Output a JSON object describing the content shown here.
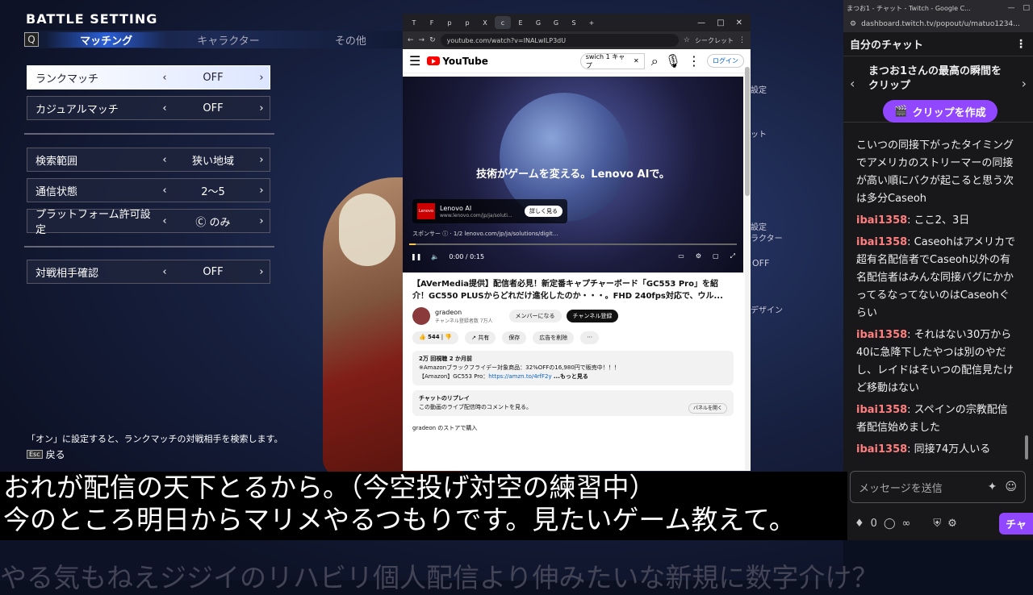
{
  "game": {
    "title": "BATTLE SETTING",
    "q_key": "Q",
    "tabs": [
      "マッチング",
      "キャラクター",
      "その他"
    ],
    "rows": [
      {
        "label": "ランクマッチ",
        "value": "OFF"
      },
      {
        "label": "カジュアルマッチ",
        "value": "OFF"
      },
      {
        "label": "検索範囲",
        "value": "狭い地域"
      },
      {
        "label": "通信状態",
        "value": "2～5"
      },
      {
        "label": "プラットフォーム許可設定",
        "value": "Ⓒ のみ"
      },
      {
        "label": "対戦相手確認",
        "value": "OFF"
      }
    ],
    "arrow_left": "‹",
    "arrow_right": "›",
    "hint": "「オン」に設定すると、ランクマッチの対戦相手を検索します。",
    "esc": "Esc",
    "back": "戻る",
    "peek": [
      "設定",
      "ット",
      "設定",
      "ラクター",
      "OFF",
      "デザイン"
    ]
  },
  "subtitles": {
    "line1": "おれが配信の天下とるから。（今空投げ対空の練習中）",
    "line2": "今のところ明日からマリメやるつもりです。見たいゲーム教えて。",
    "ghost": "やる気もねえジジイのリハビリ個人配信より伸みたいな新規に数字介け？"
  },
  "browser": {
    "tabs": [
      "T",
      "F",
      "p",
      "p",
      "X",
      "c",
      "E",
      "G",
      "G",
      "S"
    ],
    "url": "youtube.com/watch?v=INALwILP3dU",
    "incognito": "シークレット",
    "yt_logo": "YouTube",
    "search_value": "swich 1 キャプ",
    "login": "ログイン",
    "video_text": "技術がゲームを変える。Lenovo AIで。",
    "ad_logo": "Lenovo",
    "ad_name": "Lenovo AI",
    "ad_url": "www.lenovo.com/jp/ja/soluti...",
    "ad_button": "詳しく見る",
    "sponsor": "スポンサー ⓘ · 1/2  lenovo.com/jp/ja/solutions/digit...",
    "progress": 0.02,
    "time": "0:00 / 0:15",
    "video_title": "【AVerMedia提供】配信者必見！新定番キャプチャーボード「GC553 Pro」を紹介！GC550 PLUSからどれだけ進化したのか・・・。FHD 240fps対応で、ウル...",
    "channel": "gradeon",
    "subscribers": "チャンネル登録者数 7万人",
    "member_btn": "メンバーになる",
    "subscribe_btn": "チャンネル登録",
    "likes": "544",
    "share": "共有",
    "save": "保存",
    "remove_ad": "広告を削除",
    "desc_line1": "2万 回視聴  2 か月前",
    "desc_line2": "※Amazonブラックフライデー対象商品：32%OFFの16,980円で販売中！！！",
    "desc_line3_prefix": "【Amazon】GC553 Pro：",
    "desc_link": "https://amzn.to/4rfF2y",
    "desc_more": "...もっと見る",
    "replay_title": "チャットのリプレイ",
    "replay_text": "この動画のライブ配信時のコメントを見る。",
    "replay_btn": "パネルを開く",
    "store": "gradeon のストアで購入"
  },
  "twitch": {
    "window_title": "まつお1 - チャット - Twitch - Google C...",
    "url": "dashboard.twitch.tv/popout/u/matuo1234...",
    "header": "自分のチャット",
    "clip_text": "まつお1さんの最高の瞬間をクリップ",
    "clip_button": "クリップを作成",
    "messages": [
      {
        "user": "",
        "text": "こいつの同接下がったタイミングでアメリカのストリーマーの同接が高い順にバクが起こると思う次は多分Caseoh"
      },
      {
        "user": "ibai1358",
        "text": ": ここ2、3日"
      },
      {
        "user": "ibai1358",
        "text": ": Caseohはアメリカで超有名配信者でCaseoh以外の有名配信者はみんな同接バグにかかってるなってないのはCaseohぐらい"
      },
      {
        "user": "ibai1358",
        "text": ": それはない30万から40に急降下したやつは別のやだし、レイドはそいつの配信見たけど移動はない"
      },
      {
        "user": "ibai1358",
        "text": ": スペインの宗教配信者配信始めました"
      },
      {
        "user": "ibai1358",
        "text": ": 同接74万人いる"
      }
    ],
    "input_placeholder": "メッセージを送信",
    "points": "0",
    "infinity": "∞",
    "send": "チャ"
  }
}
